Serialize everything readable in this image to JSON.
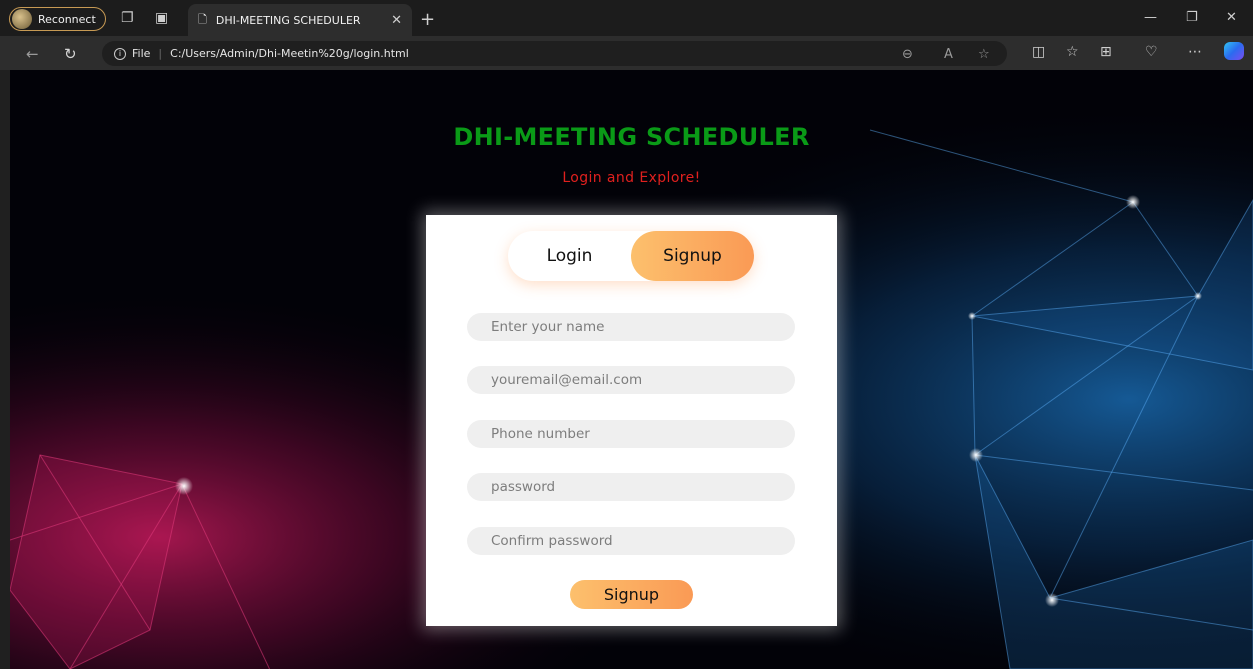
{
  "browser": {
    "profile_label": "Reconnect",
    "tab_title": "DHI-MEETING SCHEDULER",
    "address": {
      "scheme_label": "File",
      "url": "C:/Users/Admin/Dhi-Meetin%20g/login.html"
    }
  },
  "page": {
    "title": "DHI-MEETING SCHEDULER",
    "subtitle": "Login and Explore!",
    "colors": {
      "title": "#0a9a17",
      "subtitle": "#e0201e",
      "accent_start": "#fcc06d",
      "accent_end": "#fa9a55"
    },
    "toggle": {
      "login_label": "Login",
      "signup_label": "Signup",
      "active": "Signup"
    },
    "form": {
      "name_placeholder": "Enter your name",
      "email_placeholder": "youremail@email.com",
      "phone_placeholder": "Phone number",
      "password_placeholder": "password",
      "confirm_placeholder": "Confirm password",
      "submit_label": "Signup"
    }
  },
  "icons": [
    "avatar",
    "workspaces-icon",
    "tab-actions-icon",
    "page-icon",
    "close-icon",
    "new-tab-icon",
    "minimize-icon",
    "restore-icon",
    "window-close-icon",
    "back-icon",
    "refresh-icon",
    "info-icon",
    "zoom-icon",
    "read-aloud-icon",
    "favorite-icon",
    "split-screen-icon",
    "favorites-icon",
    "collections-icon",
    "performance-icon",
    "more-icon",
    "copilot-icon"
  ]
}
